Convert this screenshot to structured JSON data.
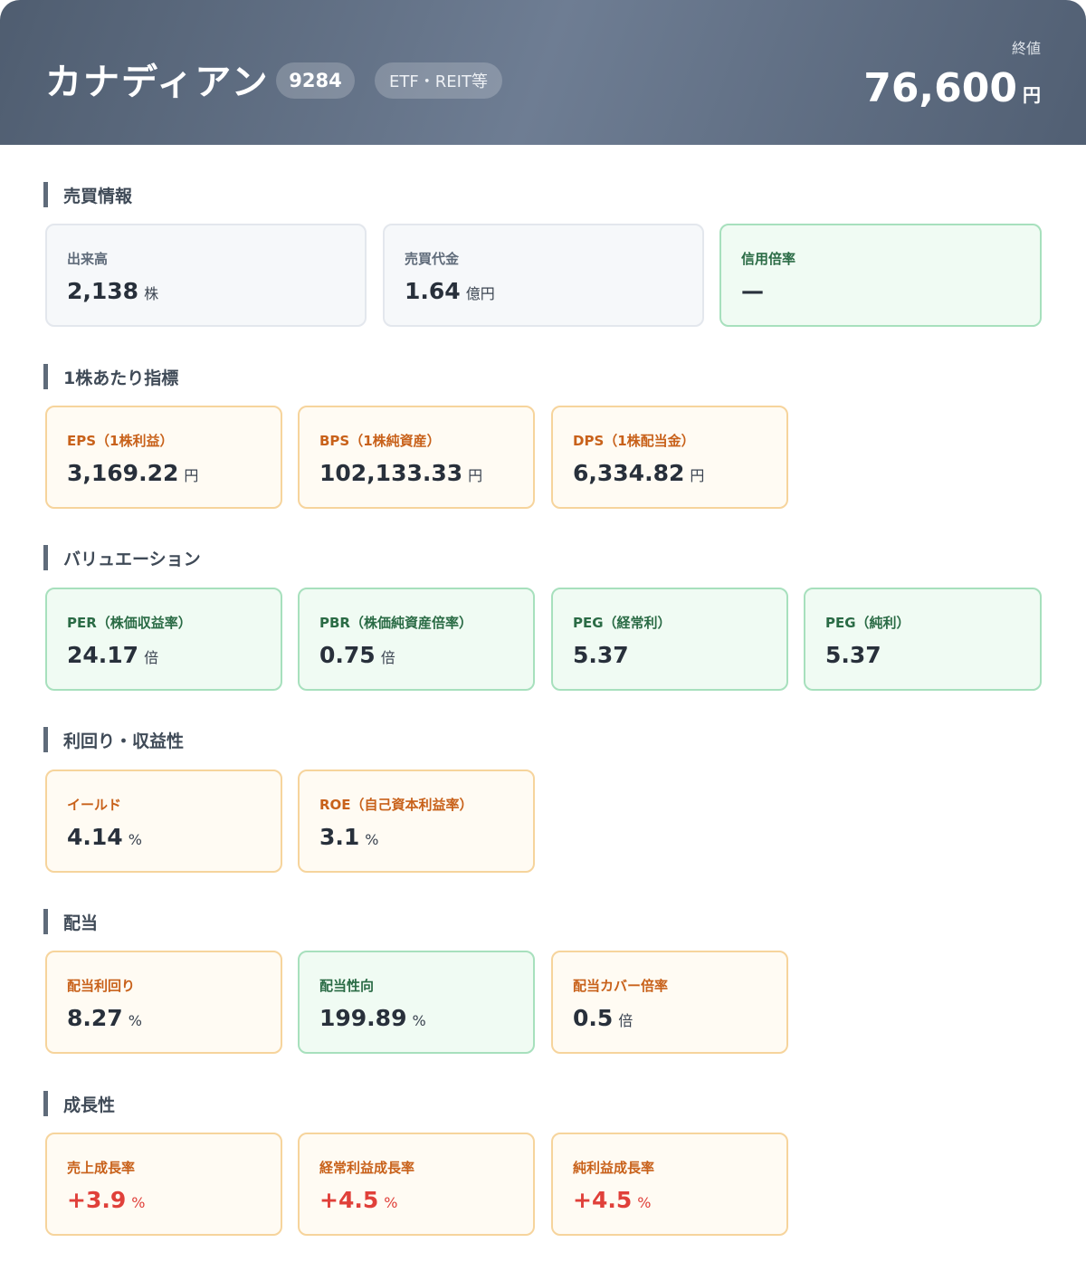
{
  "header": {
    "title": "カナディアン",
    "code": "9284",
    "category": "ETF・REIT等",
    "close_label": "終値",
    "close_value": "76,600",
    "close_unit": "円"
  },
  "sections": [
    {
      "title": "売買情報",
      "cards": [
        {
          "label": "出来高",
          "value": "2,138",
          "unit": "株"
        },
        {
          "label": "売買代金",
          "value": "1.64",
          "unit": "億円"
        },
        {
          "label": "信用倍率",
          "value": "—",
          "unit": ""
        }
      ]
    },
    {
      "title": "1株あたり指標",
      "cards": [
        {
          "label": "EPS（1株利益）",
          "value": "3,169.22",
          "unit": "円"
        },
        {
          "label": "BPS（1株純資産）",
          "value": "102,133.33",
          "unit": "円"
        },
        {
          "label": "DPS（1株配当金）",
          "value": "6,334.82",
          "unit": "円"
        }
      ]
    },
    {
      "title": "バリュエーション",
      "cards": [
        {
          "label": "PER（株価収益率）",
          "value": "24.17",
          "unit": "倍"
        },
        {
          "label": "PBR（株価純資産倍率）",
          "value": "0.75",
          "unit": "倍"
        },
        {
          "label": "PEG（経常利）",
          "value": "5.37",
          "unit": ""
        },
        {
          "label": "PEG（純利）",
          "value": "5.37",
          "unit": ""
        }
      ]
    },
    {
      "title": "利回り・収益性",
      "cards": [
        {
          "label": "イールド",
          "value": "4.14",
          "unit": "%"
        },
        {
          "label": "ROE（自己資本利益率）",
          "value": "3.1",
          "unit": "%"
        }
      ]
    },
    {
      "title": "配当",
      "cards": [
        {
          "label": "配当利回り",
          "value": "8.27",
          "unit": "%"
        },
        {
          "label": "配当性向",
          "value": "199.89",
          "unit": "%"
        },
        {
          "label": "配当カバー倍率",
          "value": "0.5",
          "unit": "倍"
        }
      ]
    },
    {
      "title": "成長性",
      "cards": [
        {
          "label": "売上成長率",
          "value": "+3.9",
          "unit": "%"
        },
        {
          "label": "経常利益成長率",
          "value": "+4.5",
          "unit": "%"
        },
        {
          "label": "純利益成長率",
          "value": "+4.5",
          "unit": "%"
        }
      ]
    }
  ],
  "colors": {
    "header_bg": "#5f6d82",
    "green_card": "#f0fbf3",
    "orange_card": "#fffbf3",
    "gray_card": "#f6f8fa",
    "positive": "#e0403a"
  }
}
